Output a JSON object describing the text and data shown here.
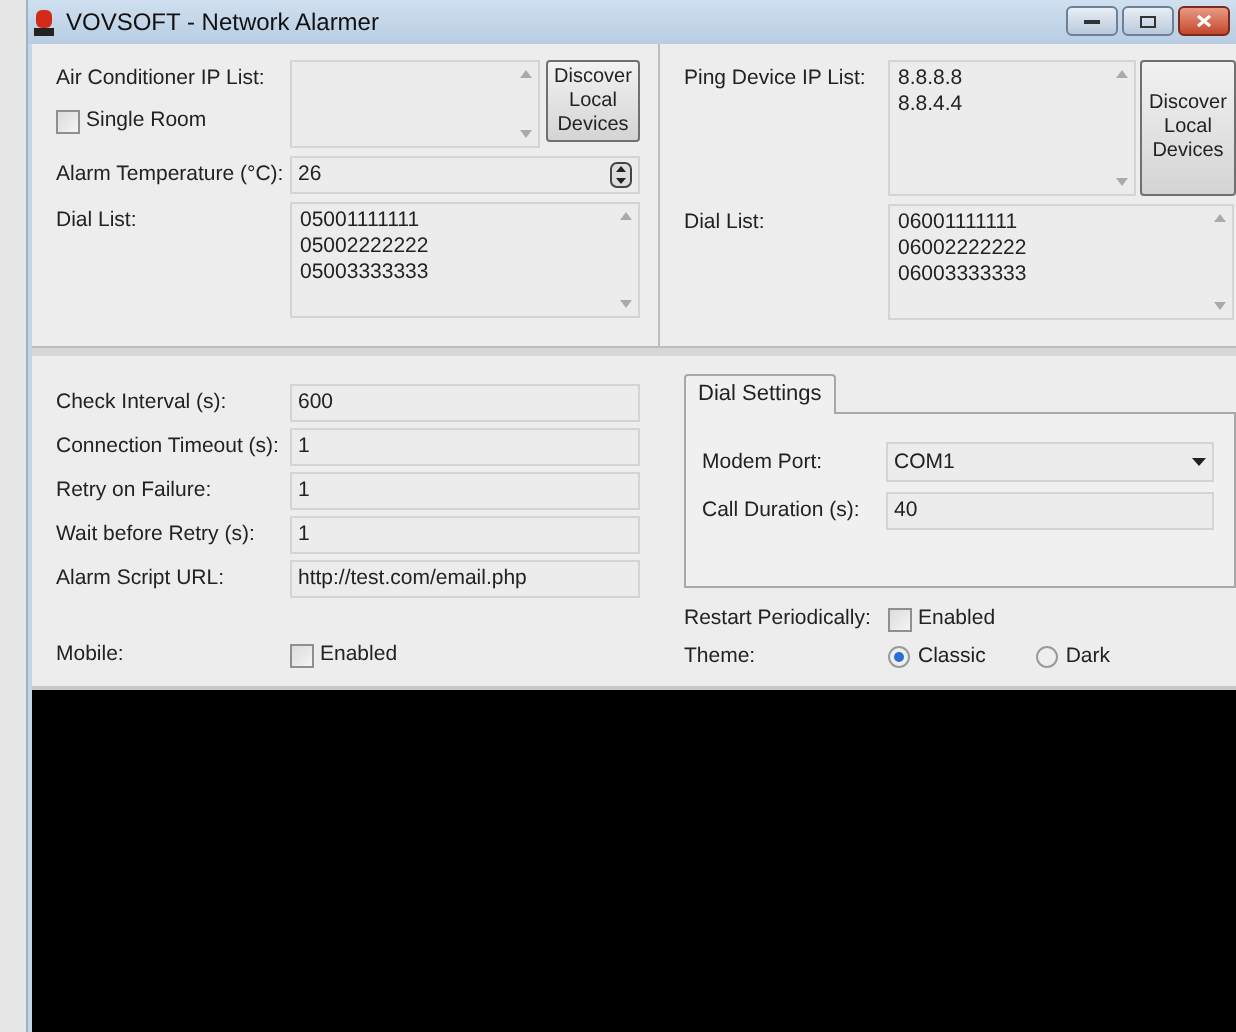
{
  "window": {
    "title": "VOVSOFT - Network Alarmer"
  },
  "left_panel": {
    "ip_list": {
      "label": "Air Conditioner IP List:"
    },
    "single_room": {
      "label": "Single Room",
      "checked": false
    },
    "discover_button": "Discover Local Devices",
    "alarm_temperature": {
      "label": "Alarm Temperature (°C):",
      "value": "26"
    },
    "dial_list": {
      "label": "Dial List:",
      "lines": [
        "05001111111",
        "05002222222",
        "05003333333"
      ]
    }
  },
  "right_panel": {
    "ip_list": {
      "label": "Ping Device IP List:",
      "lines": [
        "8.8.8.8",
        "8.8.4.4"
      ]
    },
    "discover_button": "Discover Local Devices",
    "dial_list": {
      "label": "Dial List:",
      "lines": [
        "06001111111",
        "06002222222",
        "06003333333"
      ]
    }
  },
  "settings": [
    {
      "label": "Check Interval (s):",
      "value": "600"
    },
    {
      "label": "Connection Timeout (s):",
      "value": "1"
    },
    {
      "label": "Retry on Failure:",
      "value": "1"
    },
    {
      "label": "Wait before Retry (s):",
      "value": "1"
    },
    {
      "label": "Alarm Script URL:",
      "value": "http://test.com/email.php"
    }
  ],
  "mobile": {
    "label": "Mobile:",
    "option": "Enabled",
    "checked": false
  },
  "dial_settings": {
    "tabs": [
      {
        "label": "Dial Settings",
        "selected": true
      }
    ],
    "modem_port": {
      "label": "Modem Port:",
      "value": "COM1"
    },
    "call_duration": {
      "label": "Call Duration (s):",
      "value": "40"
    }
  },
  "restart_periodically": {
    "label": "Restart Periodically:",
    "option": "Enabled",
    "checked": false
  },
  "theme": {
    "label": "Theme:",
    "options": [
      {
        "label": "Classic",
        "selected": true
      },
      {
        "label": "Dark",
        "selected": false
      }
    ]
  }
}
